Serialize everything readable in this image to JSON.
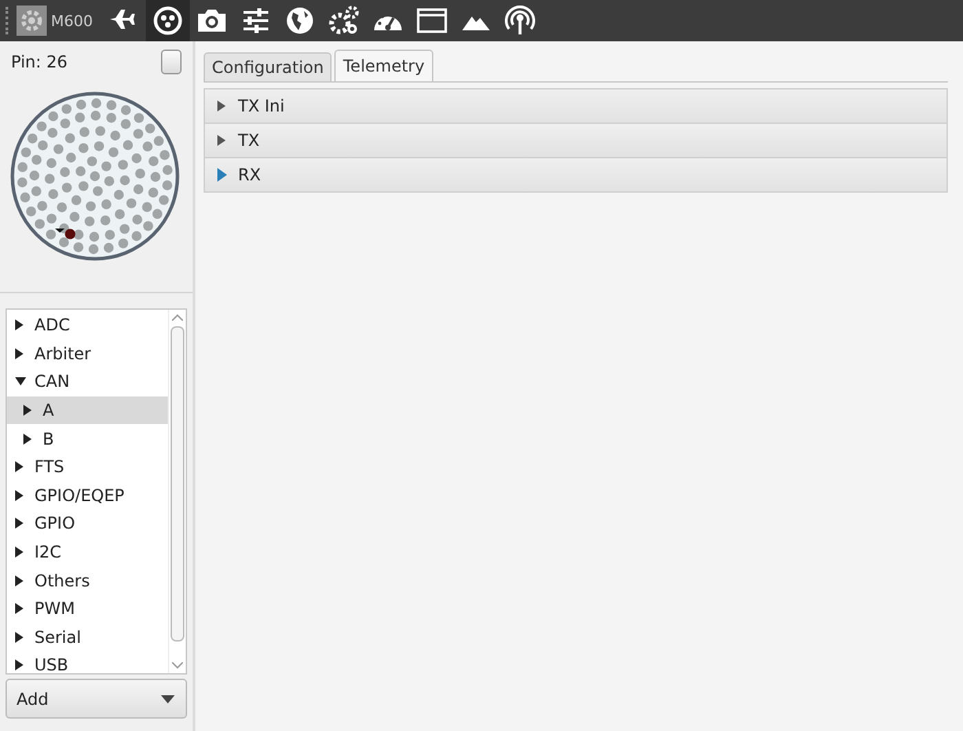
{
  "toolbar": {
    "device_label": "M600",
    "items": [
      {
        "kind": "plane",
        "selected": false
      },
      {
        "kind": "connector",
        "selected": true
      },
      {
        "kind": "camera",
        "selected": false
      },
      {
        "kind": "sliders",
        "selected": false
      },
      {
        "kind": "globe",
        "selected": false
      },
      {
        "kind": "gears",
        "selected": false
      },
      {
        "kind": "gauge",
        "selected": false
      },
      {
        "kind": "window",
        "selected": false
      },
      {
        "kind": "mountain",
        "selected": false
      },
      {
        "kind": "antenna",
        "selected": false
      }
    ]
  },
  "pin_panel": {
    "label": "Pin: 26",
    "checked": false
  },
  "tree": [
    {
      "label": "ADC",
      "expanded": false,
      "selected": false
    },
    {
      "label": "Arbiter",
      "expanded": false,
      "selected": false
    },
    {
      "label": "CAN",
      "expanded": true,
      "selected": false,
      "children": [
        {
          "label": "A",
          "expanded": false,
          "selected": true
        },
        {
          "label": "B",
          "expanded": false,
          "selected": false
        }
      ]
    },
    {
      "label": "FTS",
      "expanded": false,
      "selected": false
    },
    {
      "label": "GPIO/EQEP",
      "expanded": false,
      "selected": false
    },
    {
      "label": "GPIO",
      "expanded": false,
      "selected": false
    },
    {
      "label": "I2C",
      "expanded": false,
      "selected": false
    },
    {
      "label": "Others",
      "expanded": false,
      "selected": false
    },
    {
      "label": "PWM",
      "expanded": false,
      "selected": false
    },
    {
      "label": "Serial",
      "expanded": false,
      "selected": false
    },
    {
      "label": "USB",
      "expanded": false,
      "selected": false
    }
  ],
  "add_dropdown": {
    "label": "Add"
  },
  "tabs": [
    {
      "label": "Configuration",
      "selected": false
    },
    {
      "label": "Telemetry",
      "selected": true
    }
  ],
  "sections": [
    {
      "label": "TX Ini",
      "highlighted": false
    },
    {
      "label": "TX",
      "highlighted": false
    },
    {
      "label": "RX",
      "highlighted": true
    }
  ]
}
